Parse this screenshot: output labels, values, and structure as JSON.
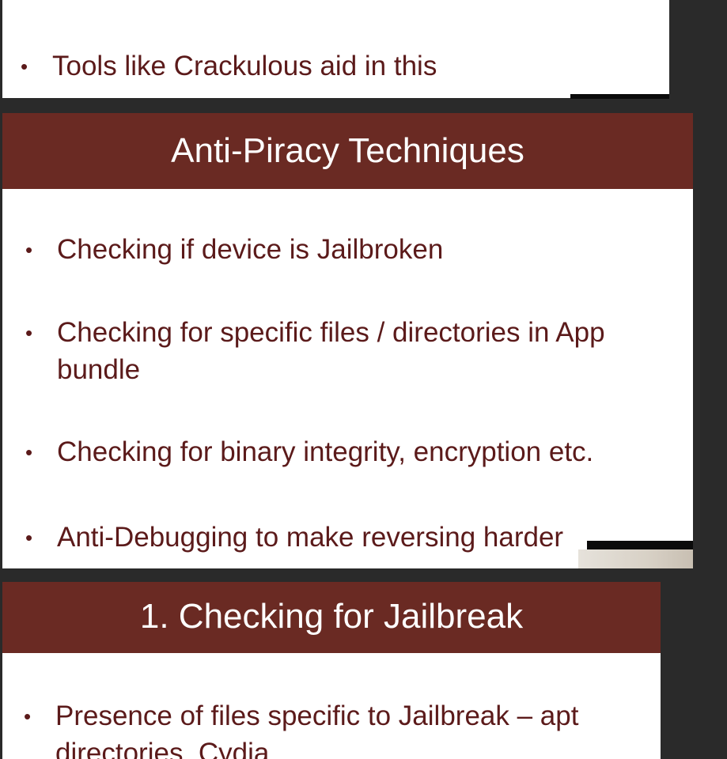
{
  "slide1": {
    "bullet": "Tools like Crackulous aid in this"
  },
  "slide2": {
    "title": "Anti-Piracy Techniques",
    "bullets": [
      [
        "Checking if device is Jailbroken"
      ],
      [
        "Checking for specific files / directories in App",
        "bundle"
      ],
      [
        "Checking for binary integrity, encryption etc."
      ],
      [
        "Anti-Debugging to make reversing harder"
      ]
    ]
  },
  "slide3": {
    "title": "1. Checking for Jailbreak",
    "bullets": [
      [
        "Presence of files specific to Jailbreak – apt",
        "directories, Cydia"
      ]
    ]
  },
  "colors": {
    "background": "#2a2a2a",
    "header": "#6a2a23",
    "bullet_text": "#5b1a1a",
    "slide_bg": "#ffffff"
  },
  "bullet_glyph": "•"
}
